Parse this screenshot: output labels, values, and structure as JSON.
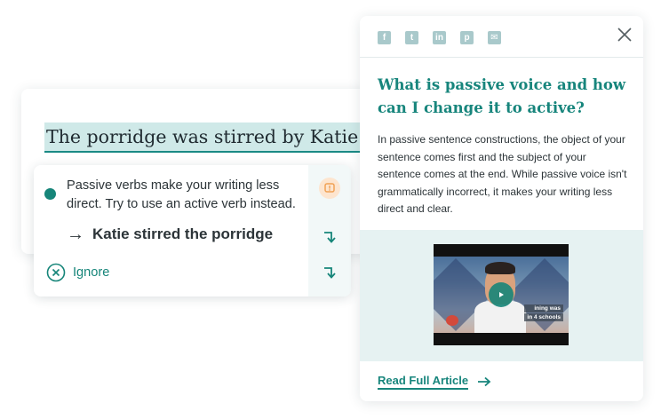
{
  "editor": {
    "sentence": "The porridge was stirred by Katie."
  },
  "suggestion": {
    "message": "Passive verbs make your writing less direct. Try to use an active verb instead.",
    "replacement": "Katie stirred the porridge",
    "ignore_label": "Ignore",
    "colors": {
      "accent": "#168579",
      "highlight": "#cfe9e8",
      "warning": "#f0a255"
    }
  },
  "article": {
    "share_icons": [
      "facebook-icon",
      "twitter-icon",
      "linkedin-icon",
      "pinterest-icon",
      "email-icon"
    ],
    "title": "What is passive voice and how can I change it to active?",
    "body": "In passive sentence constructions, the object of your sentence comes first and the subject of your sentence comes at the end. While passive voice isn't grammatically incorrect, it makes your writing less direct and clear.",
    "video": {
      "caption_line1": "ining was",
      "caption_line2": "in 4 schools"
    },
    "read_more_label": "Read Full Article"
  }
}
